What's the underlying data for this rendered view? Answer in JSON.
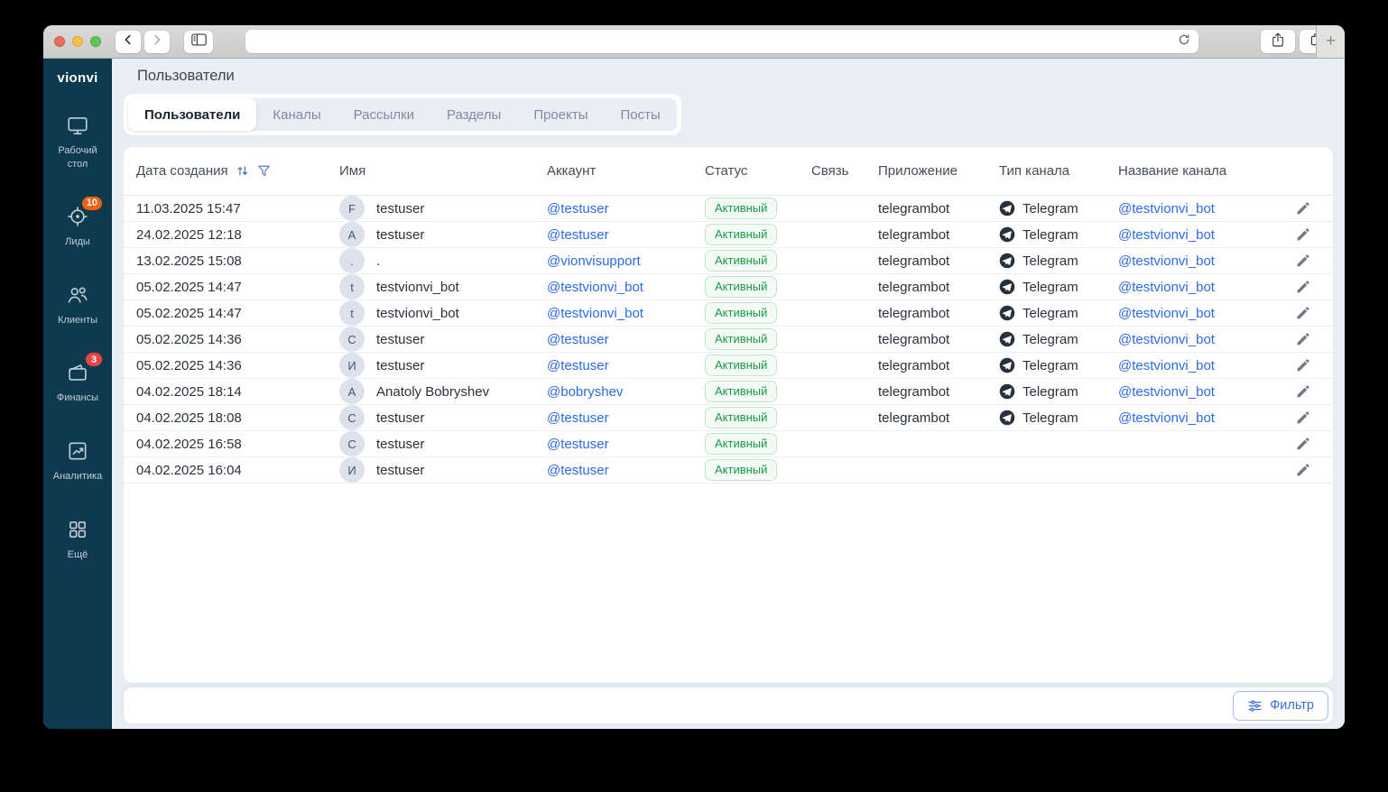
{
  "browser": {
    "url_value": ""
  },
  "sidebar": {
    "logo": "vionvi",
    "items": [
      {
        "label": "Рабочий стол",
        "icon": "monitor-icon",
        "badge": ""
      },
      {
        "label": "Лиды",
        "icon": "target-icon",
        "badge": "10"
      },
      {
        "label": "Клиенты",
        "icon": "users-icon",
        "badge": ""
      },
      {
        "label": "Финансы",
        "icon": "wallet-icon",
        "badge": "3"
      },
      {
        "label": "Аналитика",
        "icon": "chart-icon",
        "badge": ""
      },
      {
        "label": "Ещё",
        "icon": "grid-icon",
        "badge": ""
      }
    ]
  },
  "header": {
    "title": "Пользователи"
  },
  "tabs": [
    {
      "label": "Пользователи",
      "active": true
    },
    {
      "label": "Каналы",
      "active": false
    },
    {
      "label": "Рассылки",
      "active": false
    },
    {
      "label": "Разделы",
      "active": false
    },
    {
      "label": "Проекты",
      "active": false
    },
    {
      "label": "Посты",
      "active": false
    }
  ],
  "table": {
    "columns": [
      "Дата создания",
      "Имя",
      "Аккаунт",
      "Статус",
      "Связь",
      "Приложение",
      "Тип канала",
      "Название канала"
    ],
    "rows": [
      {
        "date": "11.03.2025 15:47",
        "avatar": "F",
        "name": "testuser",
        "account": "@testuser",
        "status": "Активный",
        "connection": "",
        "app": "telegrambot",
        "channel_type": "Telegram",
        "channel_name": "@testvionvi_bot"
      },
      {
        "date": "24.02.2025 12:18",
        "avatar": "A",
        "name": "testuser",
        "account": "@testuser",
        "status": "Активный",
        "connection": "",
        "app": "telegrambot",
        "channel_type": "Telegram",
        "channel_name": "@testvionvi_bot"
      },
      {
        "date": "13.02.2025 15:08",
        "avatar": ".",
        "name": ".",
        "account": "@vionvisupport",
        "status": "Активный",
        "connection": "",
        "app": "telegrambot",
        "channel_type": "Telegram",
        "channel_name": "@testvionvi_bot"
      },
      {
        "date": "05.02.2025 14:47",
        "avatar": "t",
        "name": "testvionvi_bot",
        "account": "@testvionvi_bot",
        "status": "Активный",
        "connection": "",
        "app": "telegrambot",
        "channel_type": "Telegram",
        "channel_name": "@testvionvi_bot"
      },
      {
        "date": "05.02.2025 14:47",
        "avatar": "t",
        "name": "testvionvi_bot",
        "account": "@testvionvi_bot",
        "status": "Активный",
        "connection": "",
        "app": "telegrambot",
        "channel_type": "Telegram",
        "channel_name": "@testvionvi_bot"
      },
      {
        "date": "05.02.2025 14:36",
        "avatar": "C",
        "name": "testuser",
        "account": "@testuser",
        "status": "Активный",
        "connection": "",
        "app": "telegrambot",
        "channel_type": "Telegram",
        "channel_name": "@testvionvi_bot"
      },
      {
        "date": "05.02.2025 14:36",
        "avatar": "И",
        "name": "testuser",
        "account": "@testuser",
        "status": "Активный",
        "connection": "",
        "app": "telegrambot",
        "channel_type": "Telegram",
        "channel_name": "@testvionvi_bot"
      },
      {
        "date": "04.02.2025 18:14",
        "avatar": "A",
        "name": "Anatoly Bobryshev",
        "account": "@bobryshev",
        "status": "Активный",
        "connection": "",
        "app": "telegrambot",
        "channel_type": "Telegram",
        "channel_name": "@testvionvi_bot"
      },
      {
        "date": "04.02.2025 18:08",
        "avatar": "C",
        "name": "testuser",
        "account": "@testuser",
        "status": "Активный",
        "connection": "",
        "app": "telegrambot",
        "channel_type": "Telegram",
        "channel_name": "@testvionvi_bot"
      },
      {
        "date": "04.02.2025 16:58",
        "avatar": "C",
        "name": "testuser",
        "account": "@testuser",
        "status": "Активный",
        "connection": "",
        "app": "",
        "channel_type": "",
        "channel_name": ""
      },
      {
        "date": "04.02.2025 16:04",
        "avatar": "И",
        "name": "testuser",
        "account": "@testuser",
        "status": "Активный",
        "connection": "",
        "app": "",
        "channel_type": "",
        "channel_name": ""
      }
    ]
  },
  "footer": {
    "filter_label": "Фильтр"
  },
  "colors": {
    "sidebar_bg": "#0e3a50",
    "accent_link": "#2b6be8",
    "status_green": "#199a46",
    "leads_badge_orange": "#f5620f",
    "finance_badge_red": "#ef4343",
    "page_bg": "#e9eef5"
  }
}
